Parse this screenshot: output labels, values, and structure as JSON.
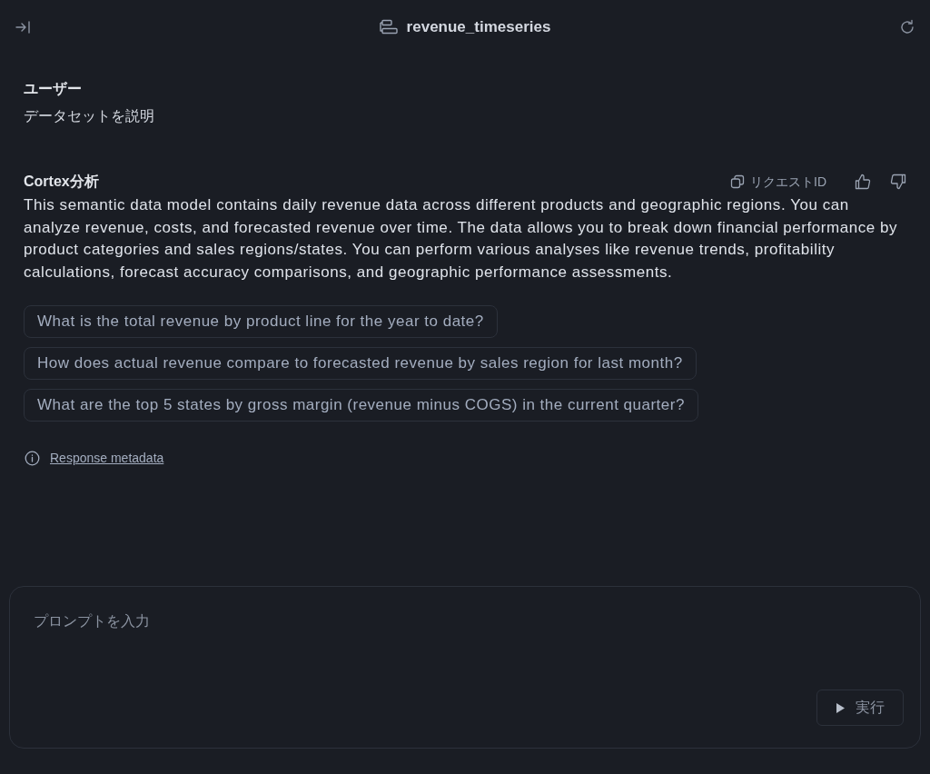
{
  "header": {
    "title": "revenue_timeseries"
  },
  "messages": [
    {
      "kind": "user",
      "author": "ユーザー",
      "text": "データセットを説明"
    },
    {
      "kind": "assistant",
      "author": "Cortex分析",
      "request_id_label": "リクエストID",
      "text": "This semantic data model contains daily revenue data across different products and geographic regions. You can analyze revenue, costs, and forecasted revenue over time. The data allows you to break down financial performance by product categories and sales regions/states. You can perform various analyses like revenue trends, profitability calculations, forecast accuracy comparisons, and geographic performance assessments.",
      "suggestions": [
        "What is the total revenue by product line for the year to date?",
        "How does actual revenue compare to forecasted revenue by sales region for last month?",
        "What are the top 5 states by gross margin (revenue minus COGS) in the current quarter?"
      ],
      "metadata_link": "Response metadata"
    }
  ],
  "prompt": {
    "placeholder": "プロンプトを入力",
    "run_label": "実行"
  }
}
